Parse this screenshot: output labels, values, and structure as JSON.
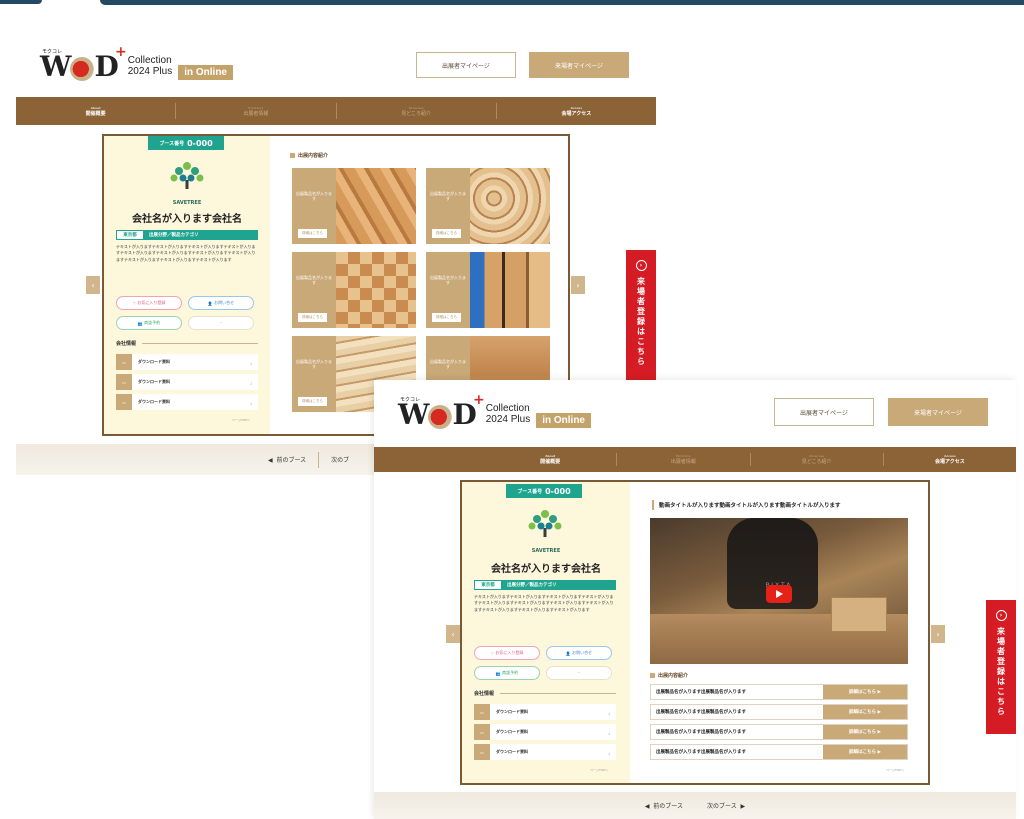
{
  "header": {
    "logo_sub": "モクコレ",
    "logo_w": "W",
    "logo_d": "D",
    "logo_plus": "+",
    "logo_collection": "Collection",
    "logo_year": "2024 Plus",
    "logo_online": "in Online",
    "exhibitor_btn": "出展者マイページ",
    "visitor_btn": "来場者マイページ"
  },
  "nav": [
    {
      "en": "About",
      "label": "開催概要"
    },
    {
      "en": "Exhibitors",
      "label": "出展者情報"
    },
    {
      "en": "Showcase",
      "label": "見どころ紹介"
    },
    {
      "en": "Access",
      "label": "会場アクセス"
    }
  ],
  "booth": {
    "label": "ブース番号",
    "number": "0-000",
    "brand": "SAVETREE",
    "company": "会社名が入ります会社名",
    "prefecture": "東京都",
    "category": "出展分野／製品カテゴリ",
    "description": "テキストが入りますテキストが入りますテキストが入りますテキストが入りますテキストが入りますテキストが入りますテキストが入りますテキストが入りますテキストが入りますテキストが入りますテキストが入ります",
    "btn_favorite": "お気に入り登録",
    "btn_inquiry": "お問い合せ",
    "btn_meeting": "商談予約",
    "btn_disabled": "ー",
    "company_info": "会社情報",
    "downloads": [
      "ダウンロード資料",
      "ダウンロード資料",
      "ダウンロード資料"
    ],
    "tiny_note": "ページTOPへ"
  },
  "products": {
    "heading": "出展内容紹介",
    "cards": [
      {
        "name": "出展製品名が入ります",
        "detail": "詳細はこちら"
      },
      {
        "name": "出展製品名が入ります",
        "detail": "詳細はこちら"
      },
      {
        "name": "出展製品名が入ります",
        "detail": "詳細はこちら"
      },
      {
        "name": "出展製品名が入ります",
        "detail": "詳細はこちら"
      },
      {
        "name": "出展製品名が入ります",
        "detail": "詳細はこちら"
      },
      {
        "name": "出展製品名が入ります",
        "detail": "詳細はこちら"
      }
    ]
  },
  "video": {
    "title": "動画タイトルが入ります動画タイトルが入ります動画タイトルが入ります",
    "watermark": "PIXTA"
  },
  "product_list": {
    "heading": "出展内容紹介",
    "rows": [
      {
        "name": "出展製品名が入ります出展製品名が入ります",
        "detail": "詳細はこちら"
      },
      {
        "name": "出展製品名が入ります出展製品名が入ります",
        "detail": "詳細はこちら"
      },
      {
        "name": "出展製品名が入ります出展製品名が入ります",
        "detail": "詳細はこちら"
      },
      {
        "name": "出展製品名が入ります出展製品名が入ります",
        "detail": "詳細はこちら"
      }
    ]
  },
  "footer": {
    "prev": "前のブース",
    "next": "次のブース",
    "next_short": "次のブ"
  },
  "side_button": {
    "label": "来場者登録はこちら"
  },
  "colors": {
    "nav_brown": "#8b6336",
    "accent_gold": "#c9a978",
    "teal": "#1fa58f",
    "red": "#d51c24"
  }
}
